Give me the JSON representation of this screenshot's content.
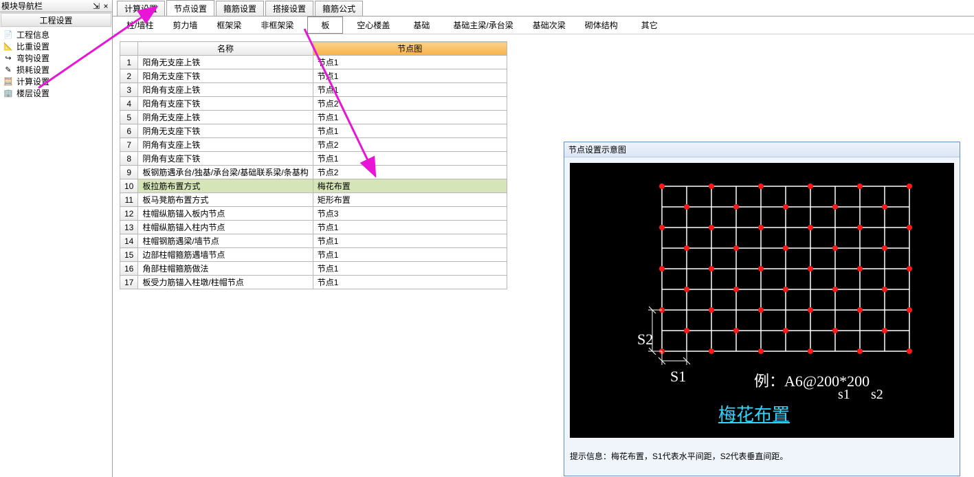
{
  "nav": {
    "title": "模块导航栏",
    "pin_glyph": "⇲",
    "close_glyph": "×",
    "section_header": "工程设置",
    "items": [
      {
        "icon": "📄",
        "label": "工程信息"
      },
      {
        "icon": "📐",
        "label": "比重设置"
      },
      {
        "icon": "↪",
        "label": "弯钩设置"
      },
      {
        "icon": "✎",
        "label": "损耗设置"
      },
      {
        "icon": "🧮",
        "label": "计算设置"
      },
      {
        "icon": "🏢",
        "label": "楼层设置"
      }
    ]
  },
  "top_tabs": [
    {
      "label": "计算设置"
    },
    {
      "label": "节点设置",
      "active": true
    },
    {
      "label": "箍筋设置"
    },
    {
      "label": "搭接设置"
    },
    {
      "label": "箍筋公式"
    }
  ],
  "sub_tabs": [
    {
      "label": "柱/墙柱"
    },
    {
      "label": "剪力墙"
    },
    {
      "label": "框架梁"
    },
    {
      "label": "非框架梁"
    },
    {
      "label": "板",
      "active": true
    },
    {
      "label": "空心楼盖"
    },
    {
      "label": "基础"
    },
    {
      "label": "基础主梁/承台梁"
    },
    {
      "label": "基础次梁"
    },
    {
      "label": "砌体结构"
    },
    {
      "label": "其它"
    }
  ],
  "table": {
    "header_name": "名称",
    "header_node": "节点图",
    "rows": [
      {
        "name": "阳角无支座上铁",
        "node": "节点1"
      },
      {
        "name": "阳角无支座下铁",
        "node": "节点1"
      },
      {
        "name": "阳角有支座上铁",
        "node": "节点1"
      },
      {
        "name": "阳角有支座下铁",
        "node": "节点2"
      },
      {
        "name": "阴角无支座上铁",
        "node": "节点1"
      },
      {
        "name": "阴角无支座下铁",
        "node": "节点1"
      },
      {
        "name": "阴角有支座上铁",
        "node": "节点2"
      },
      {
        "name": "阴角有支座下铁",
        "node": "节点1"
      },
      {
        "name": "板钢筋遇承台/独基/承台梁/基础联系梁/条基构",
        "node": "节点2"
      },
      {
        "name": "板拉筋布置方式",
        "node": "梅花布置",
        "selected": true
      },
      {
        "name": "板马凳筋布置方式",
        "node": "矩形布置"
      },
      {
        "name": "柱帽纵筋锚入板内节点",
        "node": "节点3"
      },
      {
        "name": "柱帽纵筋锚入柱内节点",
        "node": "节点1"
      },
      {
        "name": "柱帽钢筋遇梁/墙节点",
        "node": "节点1"
      },
      {
        "name": "边部柱帽箍筋遇墙节点",
        "node": "节点1"
      },
      {
        "name": "角部柱帽箍筋做法",
        "node": "节点1"
      },
      {
        "name": "板受力筋锚入柱墩/柱帽节点",
        "node": "节点1"
      }
    ]
  },
  "preview": {
    "title": "节点设置示意图",
    "s1_label": "S1",
    "s2_label": "S2",
    "example_label": "例：A6@200*200",
    "s1_small": "s1",
    "s2_small": "s2",
    "meihua_label": "梅花布置",
    "hint_prefix": "提示信息：",
    "hint_text": "梅花布置，S1代表水平间距，S2代表垂直间距。"
  }
}
